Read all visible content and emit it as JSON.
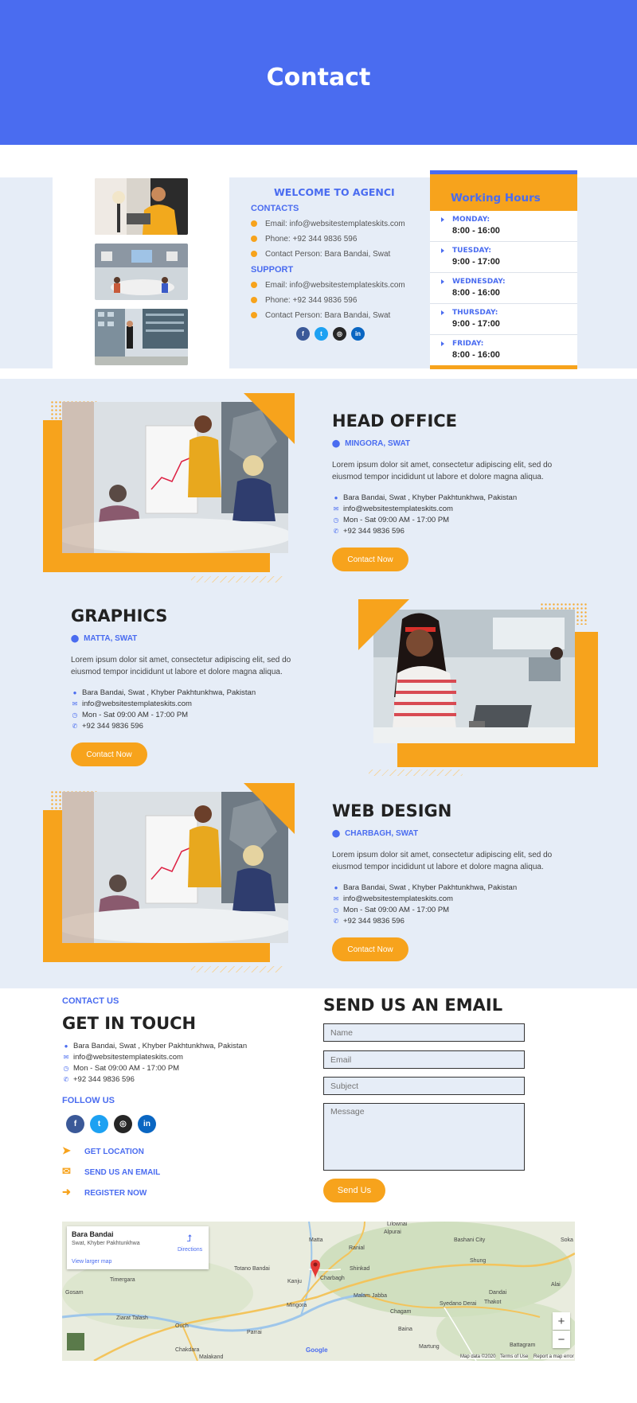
{
  "hero": {
    "title": "Contact"
  },
  "welcome": {
    "title": "WELCOME TO AGENCI",
    "contacts_label": "CONTACTS",
    "contacts": [
      "Email: info@websitestemplateskits.com",
      "Phone: +92 344 9836 596",
      "Contact Person: Bara Bandai, Swat"
    ],
    "support_label": "SUPPORT",
    "support": [
      "Email: info@websitestemplateskits.com",
      "Phone: +92 344 9836 596",
      "Contact Person: Bara Bandai, Swat"
    ],
    "social": [
      "facebook-icon",
      "twitter-icon",
      "instagram-icon",
      "linkedin-icon"
    ]
  },
  "hours": {
    "title": "Working Hours",
    "rows": [
      {
        "day": "MONDAY:",
        "time": "8:00 - 16:00"
      },
      {
        "day": "TUESDAY:",
        "time": "9:00 - 17:00"
      },
      {
        "day": "WEDNESDAY:",
        "time": "8:00 - 16:00"
      },
      {
        "day": "THURSDAY:",
        "time": "9:00 - 17:00"
      },
      {
        "day": "FRIDAY:",
        "time": "8:00 - 16:00"
      }
    ]
  },
  "offices": [
    {
      "title": "HEAD OFFICE",
      "location": "MINGORA, SWAT",
      "desc": "Lorem ipsum dolor sit amet, consectetur adipiscing elit, sed do eiusmod tempor incididunt ut labore et dolore magna aliqua.",
      "address": "Bara Bandai, Swat , Khyber Pakhtunkhwa, Pakistan",
      "email": "info@websitestemplateskits.com",
      "hours": "Mon - Sat 09:00 AM - 17:00 PM",
      "phone": "+92 344 9836 596",
      "button": "Contact Now"
    },
    {
      "title": "GRAPHICS",
      "location": "MATTA, SWAT",
      "desc": "Lorem ipsum dolor sit amet, consectetur adipiscing elit, sed do eiusmod tempor incididunt ut labore et dolore magna aliqua.",
      "address": "Bara Bandai, Swat , Khyber Pakhtunkhwa, Pakistan",
      "email": "info@websitestemplateskits.com",
      "hours": "Mon - Sat 09:00 AM - 17:00 PM",
      "phone": "+92 344 9836 596",
      "button": "Contact Now"
    },
    {
      "title": "WEB DESIGN",
      "location": "CHARBAGH, SWAT",
      "desc": "Lorem ipsum dolor sit amet, consectetur adipiscing elit, sed do eiusmod tempor incididunt ut labore et dolore magna aliqua.",
      "address": "Bara Bandai, Swat , Khyber Pakhtunkhwa, Pakistan",
      "email": "info@websitestemplateskits.com",
      "hours": "Mon - Sat 09:00 AM - 17:00 PM",
      "phone": "+92 344 9836 596",
      "button": "Contact Now"
    }
  ],
  "touch": {
    "eyebrow": "CONTACT US",
    "title": "GET IN TOUCH",
    "address": "Bara Bandai, Swat , Khyber Pakhtunkhwa, Pakistan",
    "email": "info@websitestemplateskits.com",
    "hours": "Mon - Sat 09:00 AM - 17:00 PM",
    "phone": "+92 344 9836 596",
    "follow": "FOLLOW US",
    "links": [
      "GET LOCATION",
      "SEND US AN EMAIL",
      "REGISTER NOW"
    ]
  },
  "form": {
    "title": "SEND US AN EMAIL",
    "name_placeholder": "Name",
    "email_placeholder": "Email",
    "subject_placeholder": "Subject",
    "message_placeholder": "Message",
    "send": "Send Us"
  },
  "map": {
    "place": "Bara Bandai",
    "region": "Swat, Khyber Pakhtunkhwa",
    "larger": "View larger map",
    "directions": "Directions",
    "labels": [
      "Matta",
      "Totano Bandai",
      "Kanju",
      "Charbagh",
      "Shinkad",
      "Mingora",
      "Malam Jabba",
      "Timergara",
      "Gosam",
      "Ziarat Talash",
      "Ouch",
      "Chakdara",
      "Malakand",
      "Parrai",
      "Bashani City",
      "Shung",
      "Dandai",
      "Thakot",
      "Syedano Derai",
      "Chagam",
      "Baina",
      "Martung",
      "Battagram",
      "Alpurai",
      "Lilownai",
      "Ranial",
      "Soka",
      "Alai"
    ],
    "footer_data": "Map data ©2020",
    "footer_terms": "Terms of Use",
    "footer_report": "Report a map error",
    "google": "Google",
    "zoom_in": "+",
    "zoom_out": "−"
  },
  "colors": {
    "accent": "#4a6cf0",
    "orange": "#f7a31c",
    "band": "#e6edf7"
  }
}
